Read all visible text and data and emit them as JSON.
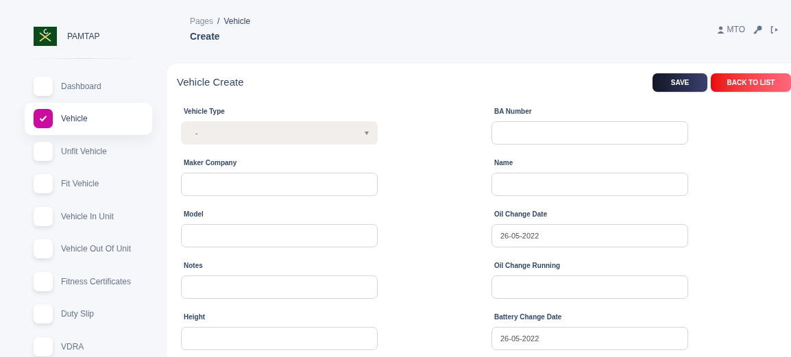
{
  "brand": {
    "name": "PAMTAP"
  },
  "sidebar": {
    "items": [
      {
        "label": "Dashboard",
        "selected": false
      },
      {
        "label": "Vehicle",
        "selected": true
      },
      {
        "label": "Unfit Vehicle",
        "selected": false
      },
      {
        "label": "Fit Vehicle",
        "selected": false
      },
      {
        "label": "Vehicle In Unit",
        "selected": false
      },
      {
        "label": "Vehicle Out Of Unit",
        "selected": false
      },
      {
        "label": "Fitness Certificates",
        "selected": false
      },
      {
        "label": "Duty Slip",
        "selected": false
      },
      {
        "label": "VDRA",
        "selected": false
      }
    ]
  },
  "header": {
    "breadcrumb": [
      "Pages",
      "/",
      "Vehicle"
    ],
    "title": "Create",
    "user": "MTO"
  },
  "card": {
    "title": "Vehicle Create",
    "buttons": [
      {
        "label": "SAVE",
        "kind": "primary"
      },
      {
        "label": "BACK TO LIST",
        "kind": "danger"
      }
    ],
    "fields": [
      {
        "label": "Vehicle Type",
        "kind": "select",
        "value": "-",
        "disabled": true
      },
      {
        "label": "BA Number",
        "kind": "input",
        "disabled": false
      },
      {
        "label": "Maker Company",
        "kind": "input",
        "disabled": false
      },
      {
        "label": "Name",
        "kind": "input",
        "disabled": false
      },
      {
        "label": "Model",
        "kind": "input",
        "disabled": false
      },
      {
        "label": "Oil Change Date",
        "kind": "input",
        "value": "26-05-2022",
        "disabled": false
      },
      {
        "label": "Notes",
        "kind": "input",
        "disabled": false
      },
      {
        "label": "Oil Change Running",
        "kind": "input",
        "disabled": false
      },
      {
        "label": "Height",
        "kind": "input",
        "disabled": false
      },
      {
        "label": "Battery Change Date",
        "kind": "input",
        "value": "26-05-2022",
        "disabled": false
      }
    ]
  }
}
